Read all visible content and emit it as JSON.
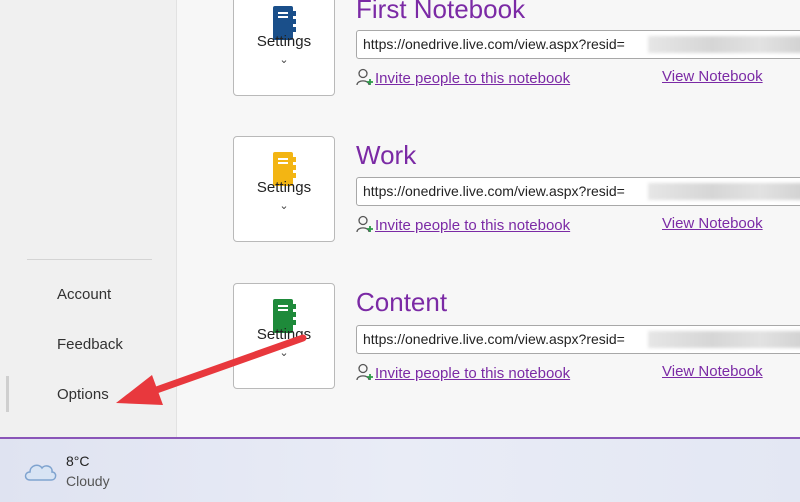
{
  "sidebar": {
    "items": [
      {
        "label": "Account"
      },
      {
        "label": "Feedback"
      },
      {
        "label": "Options"
      }
    ]
  },
  "notebooks": [
    {
      "name": "First Notebook",
      "icon_color": "#1a4f8a",
      "settings_label": "Settings",
      "url": "https://onedrive.live.com/view.aspx?resid=",
      "invite_label": "Invite people to this notebook",
      "view_label": "View Notebook"
    },
    {
      "name": "Work",
      "icon_color": "#f3b513",
      "settings_label": "Settings",
      "url": "https://onedrive.live.com/view.aspx?resid=",
      "invite_label": "Invite people to this notebook",
      "view_label": "View Notebook"
    },
    {
      "name": "Content",
      "icon_color": "#1e8a3a",
      "settings_label": "Settings",
      "url": "https://onedrive.live.com/view.aspx?resid=",
      "invite_label": "Invite people to this notebook",
      "view_label": "View Notebook"
    }
  ],
  "taskbar": {
    "weather": {
      "temperature": "8°C",
      "condition": "Cloudy",
      "icon": "cloud-icon"
    }
  },
  "colors": {
    "accent": "#7b2aa5",
    "annotation_arrow": "#e8383d"
  }
}
